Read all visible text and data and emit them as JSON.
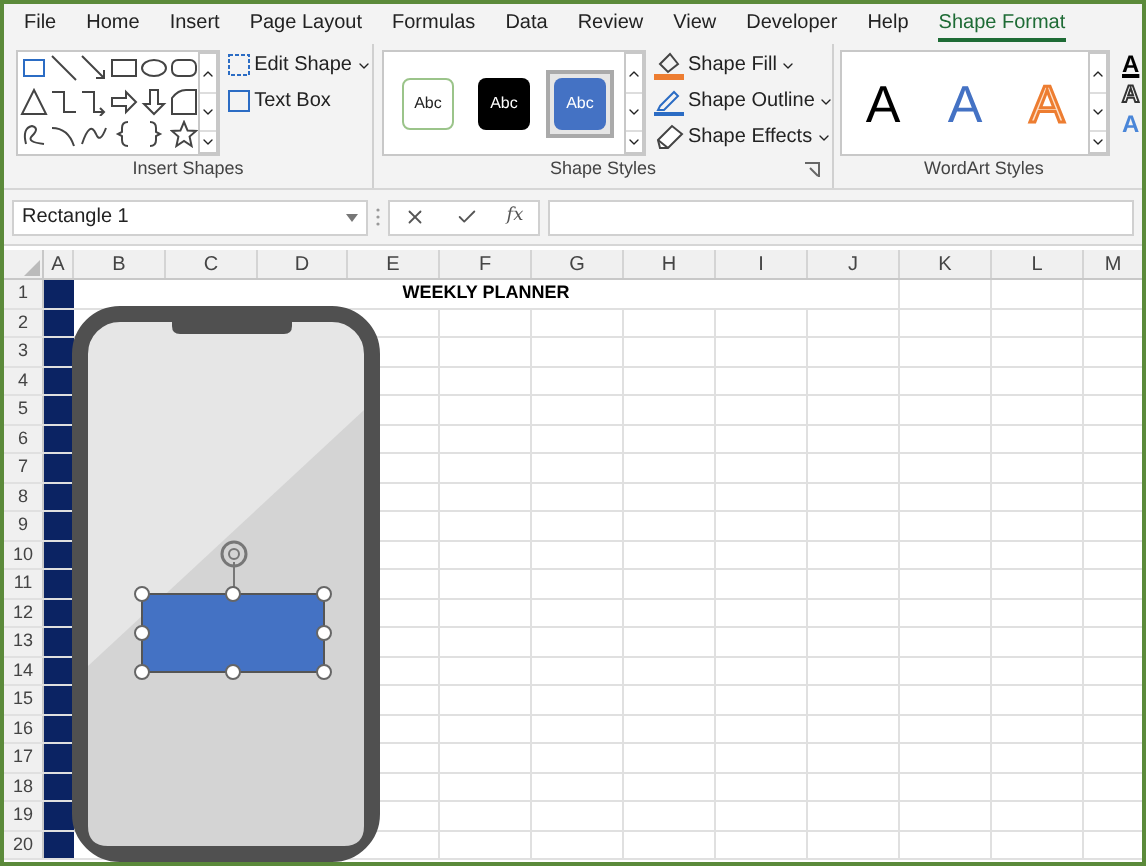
{
  "tabs": [
    {
      "label": "File",
      "selected": false
    },
    {
      "label": "Home",
      "selected": false
    },
    {
      "label": "Insert",
      "selected": false
    },
    {
      "label": "Page Layout",
      "selected": false
    },
    {
      "label": "Formulas",
      "selected": false
    },
    {
      "label": "Data",
      "selected": false
    },
    {
      "label": "Review",
      "selected": false
    },
    {
      "label": "View",
      "selected": false
    },
    {
      "label": "Developer",
      "selected": false
    },
    {
      "label": "Help",
      "selected": false
    },
    {
      "label": "Shape Format",
      "selected": true
    }
  ],
  "ribbon": {
    "insert_shapes": {
      "label": "Insert Shapes",
      "commands": [
        {
          "label": "Edit Shape",
          "dropdown": true
        },
        {
          "label": "Text Box",
          "dropdown": false
        }
      ]
    },
    "shape_styles": {
      "label": "Shape Styles",
      "styles": [
        {
          "text": "Abc",
          "kind": "outline",
          "selected": false
        },
        {
          "text": "Abc",
          "kind": "dark",
          "selected": false
        },
        {
          "text": "Abc",
          "kind": "blue",
          "selected": true
        }
      ],
      "commands": [
        {
          "label": "Shape Fill",
          "kind": "fill"
        },
        {
          "label": "Shape Outline",
          "kind": "outline"
        },
        {
          "label": "Shape Effects",
          "kind": "effects"
        }
      ]
    },
    "wordart_styles": {
      "label": "WordArt Styles",
      "styles": [
        {
          "text": "A",
          "kind": "black"
        },
        {
          "text": "A",
          "kind": "blue"
        },
        {
          "text": "A",
          "kind": "orange"
        }
      ],
      "text_buttons": [
        {
          "text": "A",
          "kind": "fill"
        },
        {
          "text": "A",
          "kind": "outline"
        },
        {
          "text": "A",
          "kind": "effects"
        }
      ]
    }
  },
  "name_box": {
    "value": "Rectangle 1"
  },
  "formula_bar": {
    "function_label": "fx"
  },
  "columns": [
    "A",
    "B",
    "C",
    "D",
    "E",
    "F",
    "G",
    "H",
    "I",
    "J",
    "K",
    "L",
    "M"
  ],
  "rows": [
    "1",
    "2",
    "3",
    "4",
    "5",
    "6",
    "7",
    "8",
    "9",
    "10",
    "11",
    "12",
    "13",
    "14",
    "15",
    "16",
    "17",
    "18",
    "19",
    "20"
  ],
  "title_cell": {
    "text": "WEEKLY PLANNER"
  }
}
